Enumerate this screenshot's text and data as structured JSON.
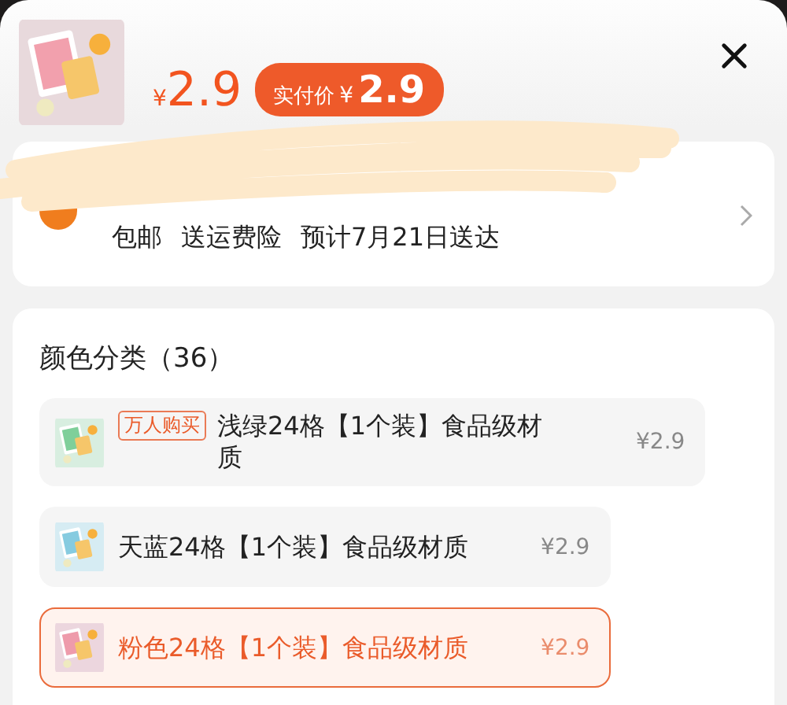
{
  "header": {
    "currency": "¥",
    "price": "2.9",
    "badge": {
      "label": "实付价",
      "currency": "¥",
      "price": "2.9"
    }
  },
  "delivery": {
    "items": [
      "包邮",
      "送运费险",
      "预计7月21日送达"
    ]
  },
  "options": {
    "title": "颜色分类（36）",
    "items": [
      {
        "tag": "万人购买",
        "name": "浅绿24格【1个装】食品级材质",
        "price": "¥2.9",
        "selected": false
      },
      {
        "name": "天蓝24格【1个装】食品级材质",
        "price": "¥2.9",
        "selected": false
      },
      {
        "name": "粉色24格【1个装】食品级材质",
        "price": "¥2.9",
        "selected": true
      }
    ]
  }
}
